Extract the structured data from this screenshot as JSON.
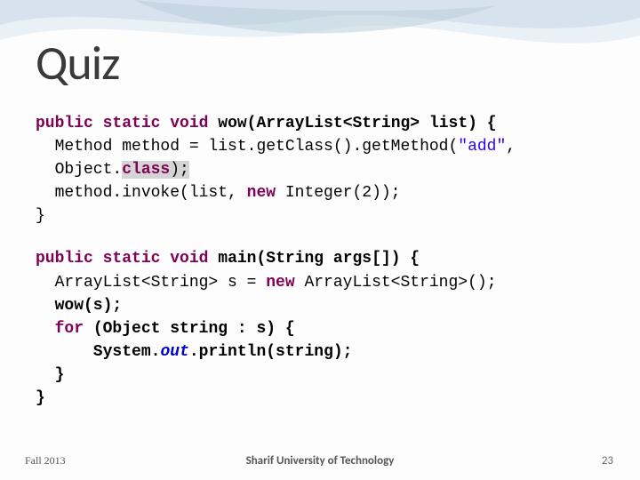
{
  "slide": {
    "title": "Quiz",
    "code1": {
      "l1a": "public",
      "l1b": " ",
      "l1c": "static",
      "l1d": " ",
      "l1e": "void",
      "l1f": " wow(ArrayList<String> list) {",
      "l2a": "  Method method = list.getClass().getMethod(",
      "l2b": "\"add\"",
      "l2c": ", ",
      "l3a": "  Object.",
      "l3b": "class",
      "l3c": ");",
      "l4a": "  method.invoke(list, ",
      "l4b": "new",
      "l4c": " Integer(2));",
      "l5": "}"
    },
    "code2": {
      "l1a": "public",
      "l1b": " ",
      "l1c": "static",
      "l1d": " ",
      "l1e": "void",
      "l1f": " main(String args[]) {",
      "l2a": "  ArrayList<String> s = ",
      "l2b": "new",
      "l2c": " ArrayList<String>();",
      "l3": "  wow(s);",
      "l4a": "  ",
      "l4b": "for",
      "l4c": " (Object string : s) {",
      "l5a": "      System.",
      "l5b": "out",
      "l5c": ".println(string);",
      "l6": "  }",
      "l7": "}"
    }
  },
  "footer": {
    "left": "Fall 2013",
    "center": "Sharif University of Technology",
    "right": "23"
  }
}
